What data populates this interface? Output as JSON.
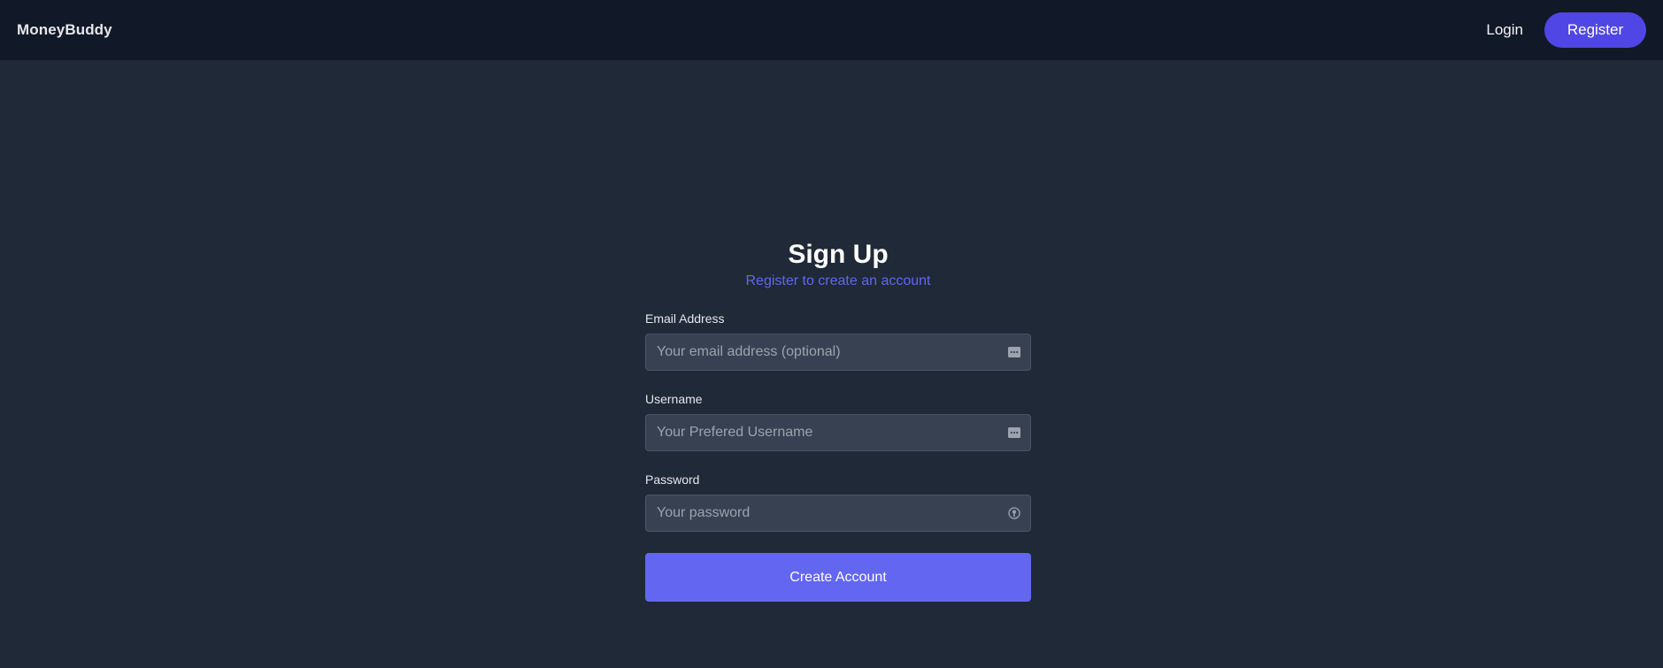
{
  "navbar": {
    "brand": "MoneyBuddy",
    "login_label": "Login",
    "register_label": "Register"
  },
  "form": {
    "title": "Sign Up",
    "subtitle": "Register to create an account",
    "fields": [
      {
        "label": "Email Address",
        "placeholder": "Your email address (optional)",
        "value": "",
        "icon": "more-dots-icon"
      },
      {
        "label": "Username",
        "placeholder": "Your Prefered Username",
        "value": "",
        "icon": "more-dots-icon"
      },
      {
        "label": "Password",
        "placeholder": "Your password",
        "value": "",
        "icon": "key-icon"
      }
    ],
    "submit_label": "Create Account"
  },
  "colors": {
    "page_bg": "#1f2937",
    "navbar_bg": "#111827",
    "accent": "#6366f1",
    "nav_button": "#4f46e5",
    "input_bg": "#374151"
  }
}
